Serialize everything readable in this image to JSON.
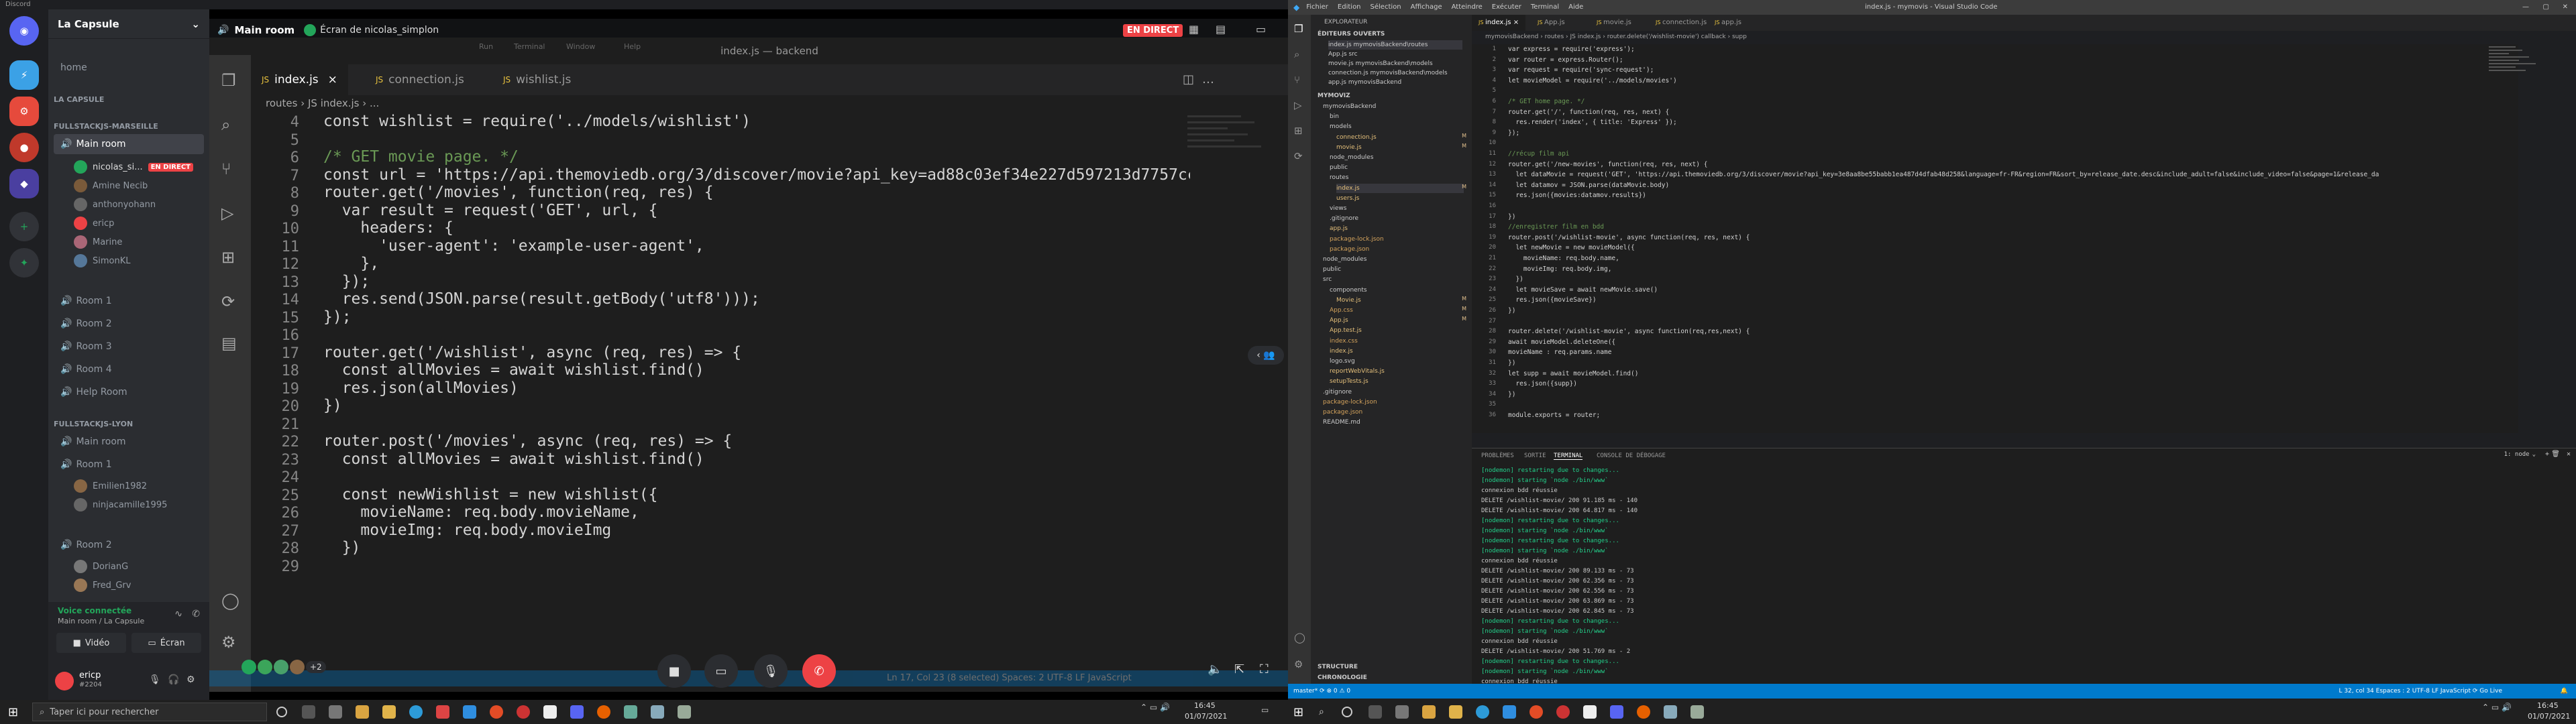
{
  "discord": {
    "title": "Discord",
    "server": "La Capsule",
    "home": "home",
    "section_lacapsule": "LA CAPSULE",
    "cat1": "FULLSTACKJS-MARSEILLE",
    "main_room": "Main room",
    "cat1_users": [
      "nicolas_si...",
      "Amine Necib",
      "anthonyohann",
      "ericp",
      "Marine",
      "SimonKL"
    ],
    "live": "EN DIRECT",
    "rooms1": [
      "Room 1",
      "Room 2",
      "Room 3",
      "Room 4",
      "Help Room"
    ],
    "cat2": "FULLSTACKJS-LYON",
    "main_room2": "Main room",
    "room1b": "Room 1",
    "room1b_users": [
      "Emilien1982",
      "ninjacamille1995"
    ],
    "room2b": "Room 2",
    "room2b_users": [
      "DorianG",
      "Fred_Grv"
    ],
    "voice_status": "Voice connectée",
    "voice_sub": "Main room / La Capsule",
    "video_btn": "Vidéo",
    "screen_btn": "Écran",
    "username": "ericp",
    "usertag": "#2204",
    "stage_room": "Main room",
    "stage_sharer": "Écran de nicolas_simplon",
    "stage_live": "EN DIRECT",
    "avatar_count": "+2"
  },
  "stream_vscode": {
    "menu": [
      "Run",
      "Terminal",
      "Window",
      "Help"
    ],
    "window_title": "index.js — backend",
    "tabs": [
      "index.js",
      "connection.js",
      "wishlist.js"
    ],
    "breadcrumb": "routes  ›  JS index.js  ›  ...",
    "line_numbers": [
      "4",
      "5",
      "6",
      "7",
      "8",
      "9",
      "10",
      "11",
      "12",
      "13",
      "14",
      "15",
      "16",
      "17",
      "18",
      "19",
      "20",
      "21",
      "22",
      "23",
      "24",
      "25",
      "26",
      "27",
      "28",
      "29"
    ],
    "lines": [
      "const wishlist = require('../models/wishlist')",
      "",
      "/* GET movie page. */",
      "const url = 'https://api.themoviedb.org/3/discover/movie?api_key=ad88c03ef34e227d597213d7757cc959&la",
      "router.get('/movies', function(req, res) {",
      "  var result = request('GET', url, {",
      "    headers: {",
      "      'user-agent': 'example-user-agent',",
      "    },",
      "  });",
      "  res.send(JSON.parse(result.getBody('utf8')));",
      "});",
      "",
      "router.get('/wishlist', async (req, res) => {",
      "  const allMovies = await wishlist.find()",
      "  res.json(allMovies)",
      "})",
      "",
      "router.post('/movies', async (req, res) => {",
      "  const allMovies = await wishlist.find()",
      "",
      "  const newWishlist = new wishlist({",
      "    movieName: req.body.movieName,",
      "    movieImg: req.body.movieImg",
      "  })",
      ""
    ],
    "status_right": "Ln 17, Col 23 (8 selected)   Spaces: 2   UTF-8   LF   JavaScript"
  },
  "vscode": {
    "menu": [
      "Fichier",
      "Edition",
      "Sélection",
      "Affichage",
      "Atteindre",
      "Exécuter",
      "Terminal",
      "Aide"
    ],
    "title": "index.js - mymovis - Visual Studio Code",
    "explorer": "EXPLORATEUR",
    "open_editors": "ÉDITEURS OUVERTS",
    "open_files": [
      "index.js  mymovisBackend\\routes",
      "App.js  src",
      "movie.js  mymovisBackend\\models",
      "connection.js  mymovisBackend\\models",
      "app.js  mymovisBackend"
    ],
    "project": "MYMOVIZ",
    "tree": [
      "mymovisBackend",
      "bin",
      "models",
      "connection.js",
      "movie.js",
      "node_modules",
      "public",
      "routes",
      "index.js",
      "users.js",
      "views",
      ".gitignore",
      "app.js",
      "package-lock.json",
      "package.json",
      "node_modules",
      "public",
      "src",
      "components",
      "Movie.js",
      "App.css",
      "App.js",
      "App.test.js",
      "index.css",
      "index.js",
      "logo.svg",
      "reportWebVitals.js",
      "setupTests.js",
      ".gitignore",
      "package-lock.json",
      "package.json",
      "README.md"
    ],
    "outline": "STRUCTURE",
    "timeline": "CHRONOLOGIE",
    "tabs": [
      "index.js",
      "App.js",
      "movie.js",
      "connection.js",
      "app.js"
    ],
    "breadcrumb": "mymovisBackend  ›  routes  ›  JS index.js  ›  router.delete('/wishlist-movie') callback  ›  supp",
    "line_numbers": [
      "1",
      "2",
      "3",
      "4",
      "5",
      "6",
      "7",
      "8",
      "9",
      "10",
      "11",
      "12",
      "13",
      "14",
      "15",
      "16",
      "17",
      "18",
      "19",
      "20",
      "21",
      "22",
      "23",
      "24",
      "25",
      "26",
      "27",
      "28",
      "29",
      "30",
      "31",
      "32",
      "33",
      "34",
      "35",
      "36"
    ],
    "lines": [
      "var express = require('express');",
      "var router = express.Router();",
      "var request = require('sync-request');",
      "let movieModel = require('../models/movies')",
      "",
      "/* GET home page. */",
      "router.get('/', function(req, res, next) {",
      "  res.render('index', { title: 'Express' });",
      "});",
      "",
      "//récup film api",
      "router.get('/new-movies', function(req, res, next) {",
      "  let dataMovie = request('GET', 'https://api.themoviedb.org/3/discover/movie?api_key=3e8aa8be55babb1ea487d4dfab48d258&language=fr-FR&region=FR&sort_by=release_date.desc&include_adult=false&include_video=false&page=1&release_da",
      "  let datamov = JSON.parse(dataMovie.body)",
      "  res.json({movies:datamov.results})",
      "",
      "})",
      "//enregistrer film en bdd",
      "router.post('/wishlist-movie', async function(req, res, next) {",
      "  let newMovie = new movieModel({",
      "    movieName: req.body.name,",
      "    movieImg: req.body.img,",
      "  })",
      "  let movieSave = await newMovie.save()",
      "  res.json({movieSave})",
      "})",
      "",
      "router.delete('/wishlist-movie', async function(req,res,next) {",
      "await movieModel.deleteOne({",
      "movieName : req.params.name",
      "})",
      "let supp = await movieModel.find()",
      "  res.json({supp})",
      "})",
      "",
      "module.exports = router;"
    ],
    "panel_tabs": [
      "PROBLÈMES",
      "SORTIE",
      "TERMINAL",
      "CONSOLE DE DÉBOGAGE"
    ],
    "terminal_select": "1: node",
    "terminal_lines": [
      "[nodemon] restarting due to changes...",
      "[nodemon] starting `node ./bin/www`",
      "connexion bdd réussie",
      "DELETE /wishlist-movie/ 200 91.185 ms - 140",
      "DELETE /wishlist-movie/ 200 64.817 ms - 140",
      "[nodemon] restarting due to changes...",
      "[nodemon] starting `node ./bin/www`",
      "[nodemon] restarting due to changes...",
      "[nodemon] starting `node ./bin/www`",
      "connexion bdd réussie",
      "DELETE /wishlist-movie/ 200 89.133 ms - 73",
      "DELETE /wishlist-movie/ 200 62.356 ms - 73",
      "DELETE /wishlist-movie/ 200 62.556 ms - 73",
      "DELETE /wishlist-movie/ 200 63.869 ms - 73",
      "DELETE /wishlist-movie/ 200 62.845 ms - 73",
      "[nodemon] restarting due to changes...",
      "[nodemon] starting `node ./bin/www`",
      "connexion bdd réussie",
      "DELETE /wishlist-movie/ 200 51.769 ms - 2",
      "[nodemon] restarting due to changes...",
      "[nodemon] starting `node ./bin/www`",
      "connexion bdd réussie"
    ],
    "status_left": "master*  ⟳  ⊗ 0 ⚠ 0",
    "status_right": "L 32, col 34   Espaces : 2   UTF-8   LF   JavaScript   ⟳ Go Live"
  },
  "taskbar": {
    "search": "Taper ici pour rechercher",
    "time1": "16:45",
    "date1": "01/07/2021",
    "time2": "16:45",
    "date2": "01/07/2021"
  }
}
